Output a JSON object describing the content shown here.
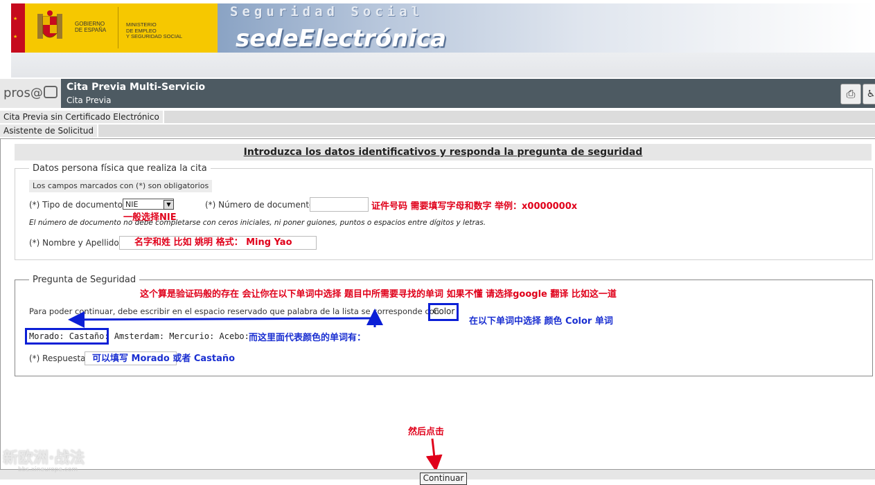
{
  "banner": {
    "gobierno": "GOBIERNO\nDE ESPAÑA",
    "ministerio": "MINISTERIO\nDE EMPLEO\nY SEGURIDAD SOCIAL",
    "seguridad_social": "Seguridad Social",
    "sede": "sedeElectrónica"
  },
  "header": {
    "logo": "pros@",
    "title": "Cita Previa Multi-Servicio",
    "subtitle": "Cita Previa",
    "print_icon": "printer-icon",
    "access_icon": "accessibility-icon"
  },
  "nav": {
    "row1": "Cita Previa sin Certificado Electrónico",
    "row2": "Asistente de Solicitud"
  },
  "main": {
    "intro": "Introduzca los datos identificativos y responda la pregunta de seguridad",
    "section1": {
      "legend": "Datos persona física que realiza la cita",
      "oblig": "Los campos marcados con (*) son obligatorios",
      "tipo_label": "(*) Tipo de documento:",
      "tipo_value": "NIE",
      "numdoc_label": "(*) Número de documento:",
      "note": "El número de documento no debe completarse con ceros iniciales, ni poner guiones, puntos o espacios entre dígitos y letras.",
      "nombre_label": "(*) Nombre y Apellidos:"
    },
    "section2": {
      "legend": "Pregunta de Seguridad",
      "question": "Para poder continuar, debe escribir en el espacio reservado que palabra de la lista se corresponde con",
      "color_word": "Color",
      "words": "Morado: Castaño: Amsterdam: Mercurio: Acebo:",
      "respuesta_label": "(*) Respuesta:"
    },
    "continuar": "Continuar"
  },
  "annotations": {
    "numdoc": "证件号码 需要填写字母和数字   举例：x0000000x",
    "tipo": "一般选择NIE",
    "nombre": "名字和姓   比如 姚明 格式：  Ming Yao",
    "captcha": "这个算是验证码般的存在  会让你在以下单词中选择 题目中所需要寻找的单词  如果不懂 请选择google 翻译   比如这一道",
    "color_hint": "在以下单词中选择 颜色 Color 单词",
    "words_hint": "而这里面代表颜色的单词有：",
    "respuesta_hint": "可以填写 Morado 或者 Castaño",
    "click": "然后点击"
  },
  "watermark": {
    "main": "新欧洲·战法",
    "sub": "bbs.xineurope.com"
  }
}
